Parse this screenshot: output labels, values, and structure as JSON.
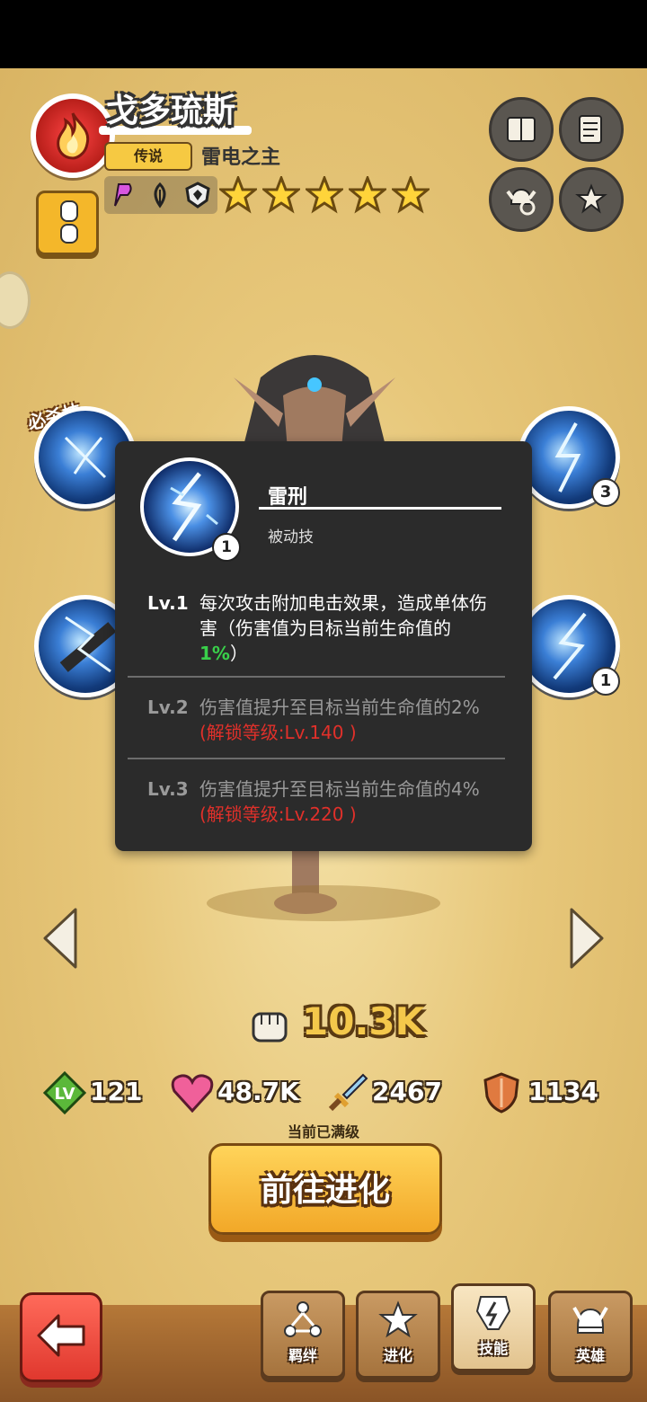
{
  "hero": {
    "name": "戈多琉斯",
    "rarity": "传说",
    "title": "雷电之主",
    "stars": 5,
    "element_icon": "fire-icon",
    "trait_icons": [
      "p-trait-icon",
      "leaf-trait-icon",
      "shield-trait-icon"
    ]
  },
  "header_buttons": [
    "book-icon",
    "scroll-icon",
    "helmet-refresh-icon",
    "star-refresh-icon"
  ],
  "skills": {
    "ultimate_label": "必杀技",
    "levels": {
      "skill_top_right": "3",
      "skill_mid_right": "1"
    }
  },
  "popup": {
    "skill_name": "雷刑",
    "skill_type": "被动技",
    "icon_level": "1",
    "levels": [
      {
        "tag": "Lv.1",
        "text_before": "每次攻击附加电击效果，造成单体伤害（伤害值为目标当前生命值的",
        "highlight": "1%",
        "text_after": "）"
      },
      {
        "tag": "Lv.2",
        "text": "伤害值提升至目标当前生命值的2% ",
        "unlock": "(解锁等级:Lv.140 )"
      },
      {
        "tag": "Lv.3",
        "text": "伤害值提升至目标当前生命值的4% ",
        "unlock": "(解锁等级:Lv.220 )"
      }
    ]
  },
  "stats": {
    "power": "10.3K",
    "level_badge": "LV",
    "level": "121",
    "hp": "48.7K",
    "attack": "2467",
    "defense": "1134"
  },
  "evolve": {
    "note": "当前已满级",
    "button_label": "前往进化"
  },
  "tabs": [
    {
      "label": "羁绊",
      "icon": "bond-icon"
    },
    {
      "label": "进化",
      "icon": "evolve-star-icon"
    },
    {
      "label": "技能",
      "icon": "skill-icon",
      "active": true
    },
    {
      "label": "英雄",
      "icon": "hero-helmet-icon"
    }
  ],
  "colors": {
    "highlight_green": "#39d04a",
    "unlock_red": "#e0302a",
    "popup_bg": "#2b2b2b",
    "gold": "#f4c84b"
  }
}
